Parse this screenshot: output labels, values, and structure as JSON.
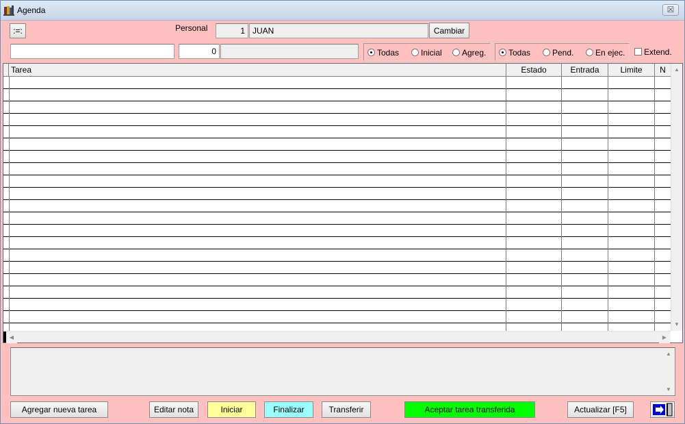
{
  "window": {
    "title": "Agenda",
    "close_glyph": "☒",
    "icon": "app-books-icon"
  },
  "top": {
    "menu_button": ":=:",
    "personal_label": "Personal",
    "personal_id": "1",
    "personal_name": "JUAN",
    "cambiar_label": "Cambiar",
    "search_value": "",
    "number_value": "0",
    "extra_value": ""
  },
  "filter_origin": {
    "options": [
      {
        "label": "Todas",
        "selected": true
      },
      {
        "label": "Inicial",
        "selected": false
      },
      {
        "label": "Agreg.",
        "selected": false
      }
    ]
  },
  "filter_state": {
    "options": [
      {
        "label": "Todas",
        "selected": true
      },
      {
        "label": "Pend.",
        "selected": false
      },
      {
        "label": "En ejec.",
        "selected": false
      }
    ]
  },
  "extend": {
    "label": "Extend.",
    "checked": false
  },
  "grid": {
    "columns": [
      "Tarea",
      "Estado",
      "Entrada",
      "Limite",
      "N"
    ],
    "rows": []
  },
  "memo": {
    "value": ""
  },
  "buttons": {
    "agregar": "Agregar nueva tarea",
    "editar": "Editar nota",
    "iniciar": "Iniciar",
    "finalizar": "Finalizar",
    "transferir": "Transferir",
    "aceptar": "Aceptar tarea transferida",
    "actualizar": "Actualizar [F5]"
  },
  "colors": {
    "background": "#ffc0c0",
    "iniciar": "#ffff99",
    "finalizar": "#99ffff",
    "aceptar": "#00ff00",
    "exit_icon": "#0000cc"
  }
}
